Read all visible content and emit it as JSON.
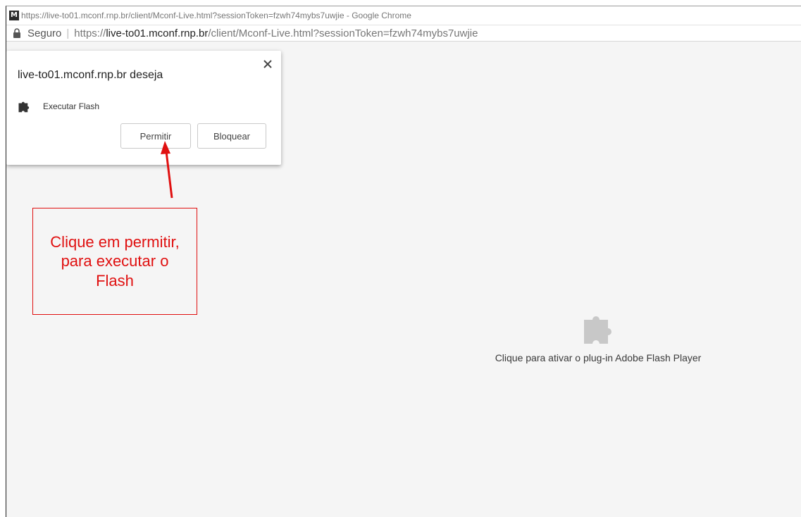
{
  "window": {
    "title": "https://live-to01.mconf.rnp.br/client/Mconf-Live.html?sessionToken=fzwh74mybs7uwjie - Google Chrome",
    "app_icon_letter": "M"
  },
  "address_bar": {
    "secure_label": "Seguro",
    "separator": "|",
    "url_scheme": "https://",
    "url_domain": "live-to01.mconf.rnp.br",
    "url_path": "/client/Mconf-Live.html?sessionToken=fzwh74mybs7uwjie"
  },
  "permission_popup": {
    "title": "live-to01.mconf.rnp.br deseja",
    "close_icon": "close-icon",
    "permission_icon": "puzzle-piece-icon",
    "permission_label": "Executar Flash",
    "allow_label": "Permitir",
    "block_label": "Bloquear"
  },
  "plugin_placeholder": {
    "icon": "puzzle-piece-icon",
    "text": "Clique para ativar o plug-in Adobe Flash Player"
  },
  "annotation": {
    "text": "Clique em permitir, para executar o Flash",
    "color": "#e01010"
  }
}
